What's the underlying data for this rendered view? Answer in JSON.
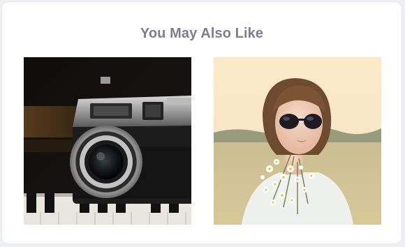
{
  "section": {
    "title": "You May Also Like"
  },
  "products": [
    {
      "image_subject": "vintage-camera-photo"
    },
    {
      "image_subject": "woman-sunglasses-flowers-photo"
    }
  ]
}
